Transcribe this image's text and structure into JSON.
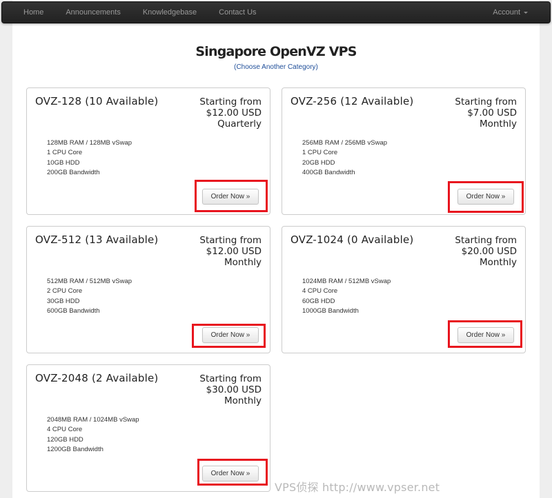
{
  "nav": {
    "links": [
      "Home",
      "Announcements",
      "Knowledgebase",
      "Contact Us"
    ],
    "account_label": "Account"
  },
  "header": {
    "title": "Singapore OpenVZ VPS",
    "category_link": "(Choose Another Category)"
  },
  "products": [
    {
      "name": "OVZ-128 (10 Available)",
      "price_prefix": "Starting from",
      "price": "$12.00 USD",
      "cycle": "Quarterly",
      "features": [
        "128MB RAM / 128MB vSwap",
        "1 CPU Core",
        "10GB HDD",
        "200GB Bandwidth"
      ],
      "order_label": "Order Now »"
    },
    {
      "name": "OVZ-256 (12 Available)",
      "price_prefix": "Starting from",
      "price": "$7.00 USD",
      "cycle": "Monthly",
      "features": [
        "256MB RAM / 256MB vSwap",
        "1 CPU Core",
        "20GB HDD",
        "400GB Bandwidth"
      ],
      "order_label": "Order Now »"
    },
    {
      "name": "OVZ-512 (13 Available)",
      "price_prefix": "Starting from",
      "price": "$12.00 USD",
      "cycle": "Monthly",
      "features": [
        "512MB RAM / 512MB vSwap",
        "2 CPU Core",
        "30GB HDD",
        "600GB Bandwidth"
      ],
      "order_label": "Order Now »"
    },
    {
      "name": "OVZ-1024 (0 Available)",
      "price_prefix": "Starting from",
      "price": "$20.00 USD",
      "cycle": "Monthly",
      "features": [
        "1024MB RAM / 512MB vSwap",
        "4 CPU Core",
        "60GB HDD",
        "1000GB Bandwidth"
      ],
      "order_label": "Order Now »"
    },
    {
      "name": "OVZ-2048 (2 Available)",
      "price_prefix": "Starting from",
      "price": "$30.00 USD",
      "cycle": "Monthly",
      "features": [
        "2048MB RAM / 1024MB vSwap",
        "4 CPU Core",
        "120GB HDD",
        "1200GB Bandwidth"
      ],
      "order_label": "Order Now »"
    }
  ],
  "watermark": "VPS侦探 http://www.vpser.net",
  "colors": {
    "navbar": "#222222",
    "nav_text": "#999999",
    "link": "#1f4e99",
    "highlight": "#e8141e",
    "page_bg": "#eeeeee"
  }
}
